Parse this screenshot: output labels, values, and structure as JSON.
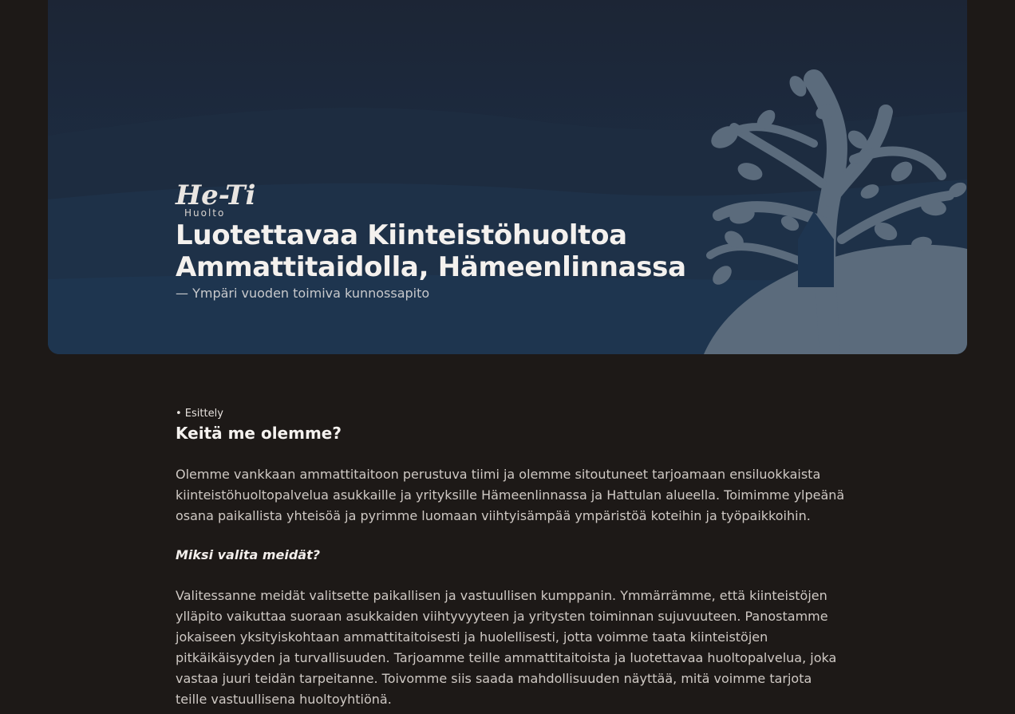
{
  "hero": {
    "logo_main": "He-Ti",
    "logo_sub": "Huolto",
    "title_line1": "Luotettavaa Kiinteistöhuoltoa",
    "title_line2": "Ammattitaidolla, Hämeenlinnassa",
    "subtitle": "— Ympäri vuoden toimiva kunnossapito"
  },
  "intro": {
    "eyebrow": "• Esittely",
    "heading": "Keitä me olemme?",
    "paragraph1": "Olemme vankkaan ammattitaitoon perustuva tiimi ja olemme sitoutuneet tarjoamaan ensiluokkaista kiinteistöhuoltopalvelua asukkaille ja yrityksille Hämeenlinnassa ja Hattulan alueella. Toimimme ylpeänä osana paikallista yhteisöä ja pyrimme luomaan viihtyisämpää ympäristöä koteihin ja työpaikkoihin.",
    "why_heading": "Miksi valita meidät?",
    "paragraph2": "Valitessanne meidät valitsette paikallisen ja vastuullisen kumppanin. Ymmärrämme, että kiinteistöjen ylläpito vaikuttaa suoraan asukkaiden viihtyvyyteen ja yritysten toiminnan sujuvuuteen. Panostamme jokaiseen yksityiskohtaan ammattitaitoisesti ja huolellisesti, jotta voimme taata kiinteistöjen pitkäikäisyyden ja turvallisuuden. Tarjoamme teille ammattitaitoista ja luotettavaa huoltopalvelua, joka vastaa juuri teidän tarpeitanne. Toivomme siis saada mahdollisuuden näyttää, mitä voimme tarjota teille vastuullisena huoltoyhtiönä."
  },
  "colors": {
    "page_bg": "#1d1917",
    "hero_bg": "#1e3754",
    "tree": "#5a6878"
  }
}
